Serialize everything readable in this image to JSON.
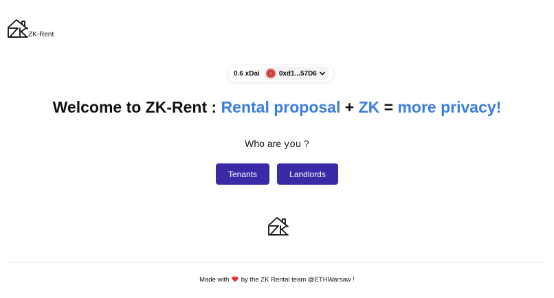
{
  "header": {
    "brand": "ZK-Rent",
    "logo_icon": "house-zk-logo-icon"
  },
  "wallet": {
    "balance": "0.6 xDai",
    "address": "0xd1...57D6",
    "avatar_color": "#e0584f"
  },
  "hero": {
    "part1": "Welcome to ZK-Rent : ",
    "part2": "Rental proposal",
    "part3": " + ",
    "part4": "ZK",
    "part5": " = ",
    "part6": "more privacy!"
  },
  "question": {
    "prefix": "Who are ",
    "code": "you",
    "suffix": " ?"
  },
  "actions": {
    "tenants": "Tenants",
    "landlords": "Landlords"
  },
  "footer": {
    "prefix": "Made with",
    "suffix": "by the ZK Rental team @ETHWarsaw !"
  },
  "colors": {
    "accent": "#3b7ddd",
    "button": "#3b2aa8",
    "heart": "#e02d2d"
  }
}
